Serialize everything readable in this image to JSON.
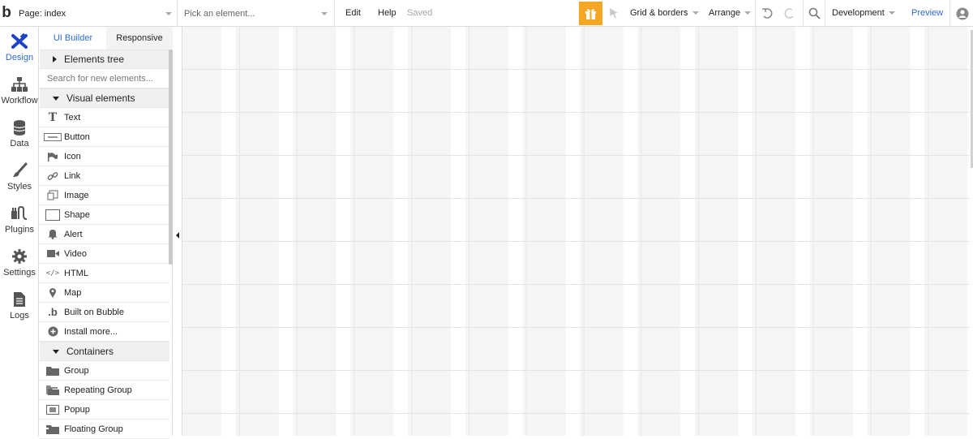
{
  "topbar": {
    "logo": "b",
    "page_select": "Page: index",
    "element_select_placeholder": "Pick an element...",
    "edit": "Edit",
    "help": "Help",
    "saved": "Saved",
    "grid_borders": "Grid & borders",
    "arrange": "Arrange",
    "environment": "Development",
    "preview": "Preview",
    "accent_color": "#f5a623",
    "link_color": "#2e6cd1"
  },
  "leftnav": {
    "items": [
      {
        "label": "Design",
        "icon": "design-icon",
        "active": true
      },
      {
        "label": "Workflow",
        "icon": "workflow-icon"
      },
      {
        "label": "Data",
        "icon": "database-icon"
      },
      {
        "label": "Styles",
        "icon": "brush-icon"
      },
      {
        "label": "Plugins",
        "icon": "plug-icon"
      },
      {
        "label": "Settings",
        "icon": "gear-icon"
      },
      {
        "label": "Logs",
        "icon": "document-icon"
      }
    ]
  },
  "panel": {
    "tabs": [
      "UI Builder",
      "Responsive"
    ],
    "elements_tree": "Elements tree",
    "search_placeholder": "Search for new elements...",
    "visual_elements_header": "Visual elements",
    "visual_elements": [
      {
        "label": "Text",
        "icon": "text-icon"
      },
      {
        "label": "Button",
        "icon": "button-icon"
      },
      {
        "label": "Icon",
        "icon": "flag-icon"
      },
      {
        "label": "Link",
        "icon": "link-icon"
      },
      {
        "label": "Image",
        "icon": "image-icon"
      },
      {
        "label": "Shape",
        "icon": "shape-icon"
      },
      {
        "label": "Alert",
        "icon": "bell-icon"
      },
      {
        "label": "Video",
        "icon": "video-icon"
      },
      {
        "label": "HTML",
        "icon": "code-icon"
      },
      {
        "label": "Map",
        "icon": "map-pin-icon"
      },
      {
        "label": "Built on Bubble",
        "icon": "bubble-logo-icon"
      },
      {
        "label": "Install more...",
        "icon": "plus-circle-icon"
      }
    ],
    "containers_header": "Containers",
    "containers": [
      {
        "label": "Group",
        "icon": "folder-icon"
      },
      {
        "label": "Repeating Group",
        "icon": "folder-stack-icon"
      },
      {
        "label": "Popup",
        "icon": "popup-icon"
      },
      {
        "label": "Floating Group",
        "icon": "folder-float-icon"
      }
    ]
  }
}
